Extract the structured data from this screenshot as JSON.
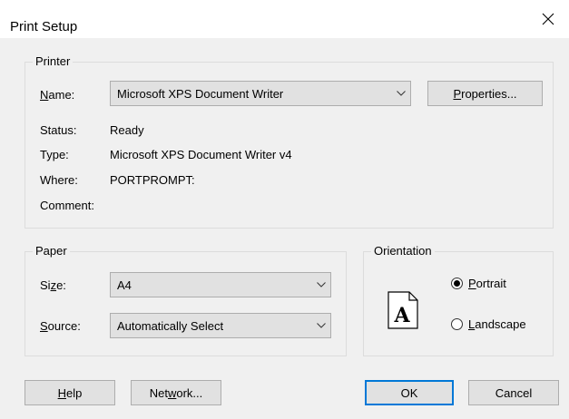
{
  "window": {
    "title": "Print Setup"
  },
  "printer": {
    "group_label": "Printer",
    "name_label_prefix": "",
    "name_label_key": "N",
    "name_label_rest": "ame:",
    "name_value": "Microsoft XPS Document Writer",
    "properties_button_key": "P",
    "properties_button_rest": "roperties...",
    "status_label": "Status:",
    "status_value": "Ready",
    "type_label": "Type:",
    "type_value": "Microsoft XPS Document Writer v4",
    "where_label": "Where:",
    "where_value": "PORTPROMPT:",
    "comment_label": "Comment:"
  },
  "paper": {
    "group_label": "Paper",
    "size_label_pre": "Si",
    "size_label_key": "z",
    "size_label_rest": "e:",
    "size_value": "A4",
    "source_label_key": "S",
    "source_label_rest": "ource:",
    "source_value": "Automatically Select"
  },
  "orientation": {
    "group_label": "Orientation",
    "portrait_key": "P",
    "portrait_rest": "ortrait",
    "landscape_key": "L",
    "landscape_rest": "andscape",
    "selected": "portrait",
    "page_letter": "A"
  },
  "buttons": {
    "help_key": "H",
    "help_rest": "elp",
    "network_pre": "Net",
    "network_key": "w",
    "network_rest": "ork...",
    "ok": "OK",
    "cancel": "Cancel"
  },
  "icons": {
    "close": "close-icon",
    "dropdown": "chevron-down-icon",
    "page": "portrait-page-icon"
  }
}
